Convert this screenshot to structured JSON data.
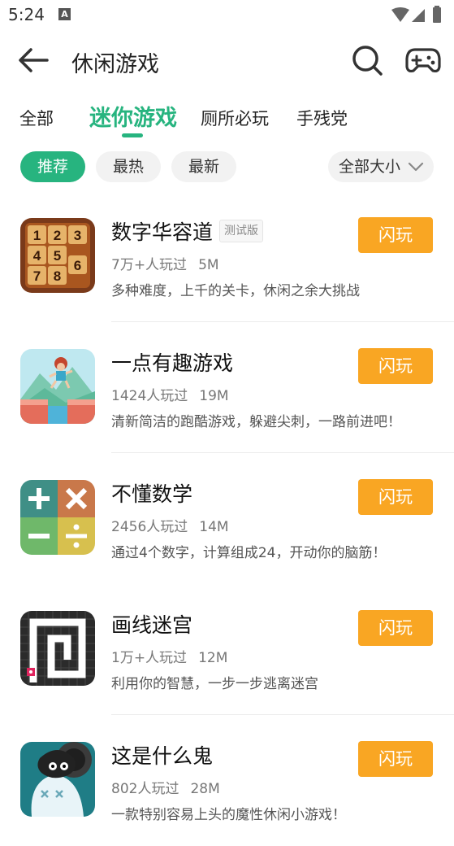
{
  "status_bar": {
    "time": "5:24",
    "notification_glyph": "A"
  },
  "app_bar": {
    "title": "休闲游戏"
  },
  "tabs": [
    {
      "label": "全部"
    },
    {
      "label": "迷你游戏",
      "active": true
    },
    {
      "label": "厕所必玩"
    },
    {
      "label": "手残党"
    }
  ],
  "filters": {
    "chips": [
      {
        "label": "推荐",
        "active": true
      },
      {
        "label": "最热"
      },
      {
        "label": "最新"
      }
    ],
    "size": {
      "label": "全部大小"
    }
  },
  "games": [
    {
      "name": "数字华容道",
      "badge": "测试版",
      "players": "7万+人玩过",
      "size": "5M",
      "desc": "多种难度，上千的关卡，休闲之余大挑战",
      "play_label": "闪玩",
      "icon": "number-slide-puzzle-icon"
    },
    {
      "name": "一点有趣游戏",
      "players": "1424人玩过",
      "size": "19M",
      "desc": "清新简洁的跑酷游戏，躲避尖刺，一路前进吧！",
      "play_label": "闪玩",
      "icon": "runner-game-icon"
    },
    {
      "name": "不懂数学",
      "players": "2456人玩过",
      "size": "14M",
      "desc": "通过4个数字，计算组成24，开动你的脑筋！",
      "play_label": "闪玩",
      "icon": "math-operators-icon"
    },
    {
      "name": "画线迷宫",
      "players": "1万+人玩过",
      "size": "12M",
      "desc": "利用你的智慧，一步一步逃离迷宫",
      "play_label": "闪玩",
      "icon": "maze-icon"
    },
    {
      "name": "这是什么鬼",
      "players": "802人玩过",
      "size": "28M",
      "desc": "一款特别容易上头的魔性休闲小游戏！",
      "play_label": "闪玩",
      "icon": "ghost-character-icon"
    }
  ],
  "colors": {
    "accent": "#27b47f",
    "play_button": "#f9a623"
  }
}
